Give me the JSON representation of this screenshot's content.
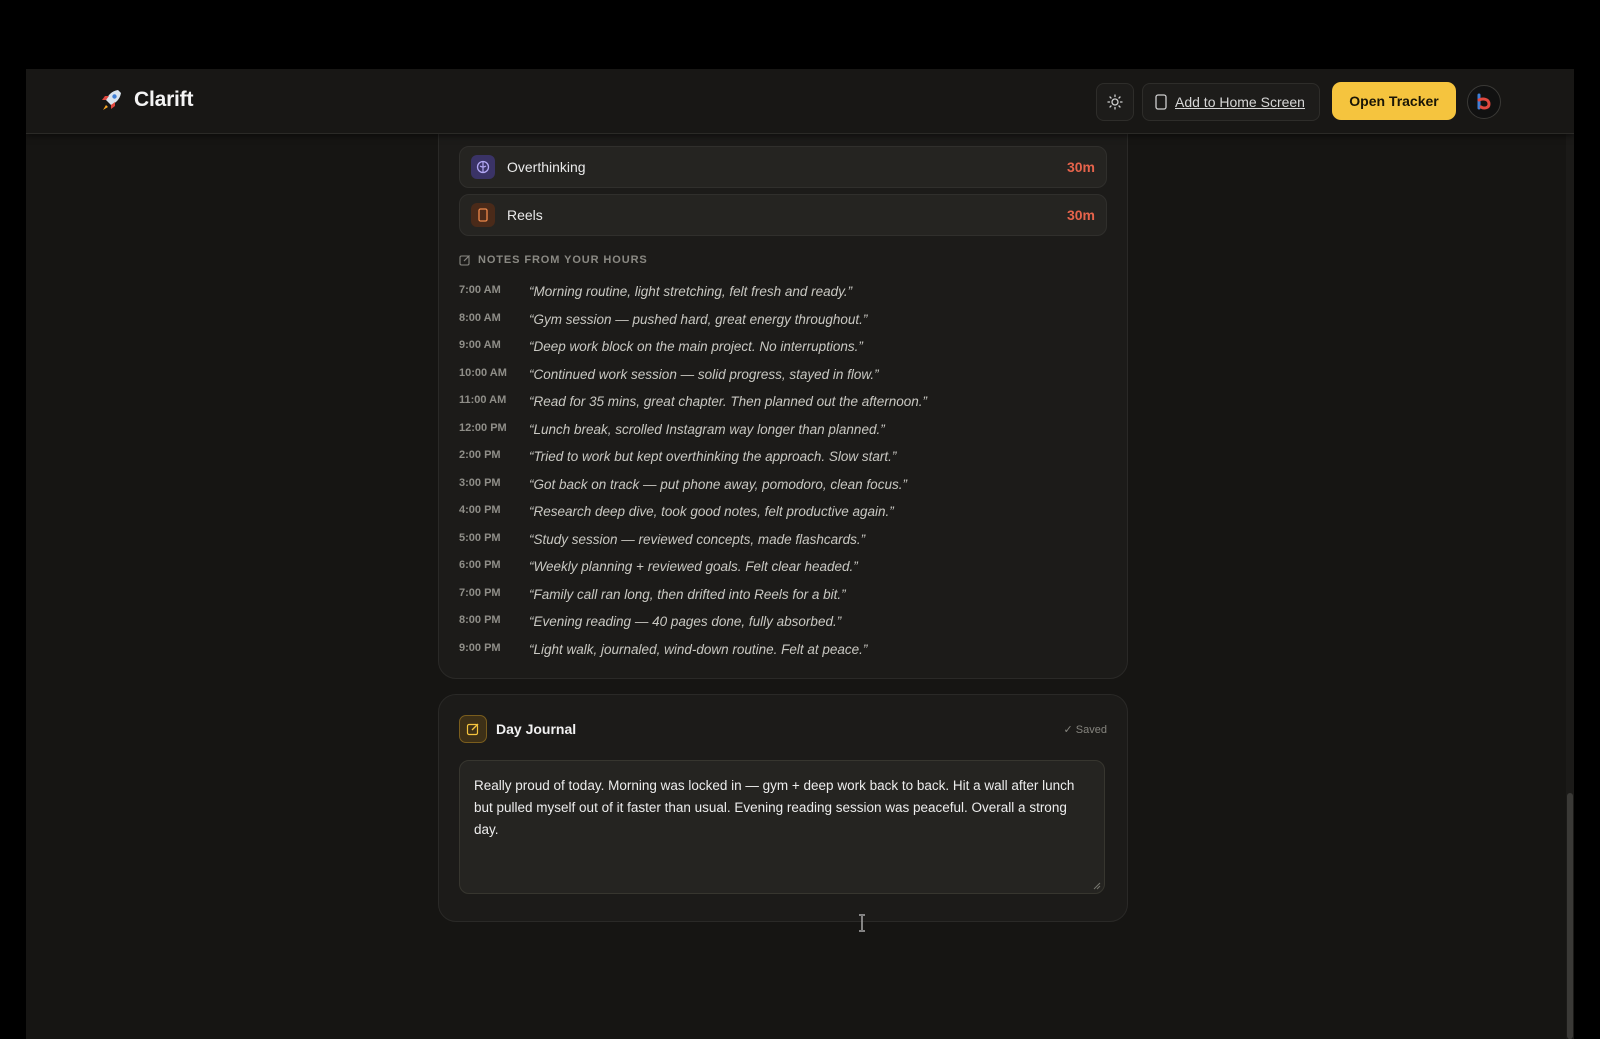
{
  "header": {
    "brand": "Clarift",
    "add_home_label": "Add to Home Screen",
    "open_tracker_label": "Open Tracker"
  },
  "habits": [
    {
      "name": "Overthinking",
      "time": "30m",
      "icon": "brain-icon",
      "color": "#7f6fd6"
    },
    {
      "name": "Reels",
      "time": "30m",
      "icon": "phone-icon",
      "color": "#e07a3c"
    }
  ],
  "notes": {
    "title": "NOTES FROM YOUR HOURS",
    "items": [
      {
        "time": "7:00 AM",
        "text": "“Morning routine, light stretching, felt fresh and ready.”"
      },
      {
        "time": "8:00 AM",
        "text": "“Gym session — pushed hard, great energy throughout.”"
      },
      {
        "time": "9:00 AM",
        "text": "“Deep work block on the main project. No interruptions.”"
      },
      {
        "time": "10:00 AM",
        "text": "“Continued work session — solid progress, stayed in flow.”"
      },
      {
        "time": "11:00 AM",
        "text": "“Read for 35 mins, great chapter. Then planned out the afternoon.”"
      },
      {
        "time": "12:00 PM",
        "text": "“Lunch break, scrolled Instagram way longer than planned.”"
      },
      {
        "time": "2:00 PM",
        "text": "“Tried to work but kept overthinking the approach. Slow start.”"
      },
      {
        "time": "3:00 PM",
        "text": "“Got back on track — put phone away, pomodoro, clean focus.”"
      },
      {
        "time": "4:00 PM",
        "text": "“Research deep dive, took good notes, felt productive again.”"
      },
      {
        "time": "5:00 PM",
        "text": "“Study session — reviewed concepts, made flashcards.”"
      },
      {
        "time": "6:00 PM",
        "text": "“Weekly planning + reviewed goals. Felt clear headed.”"
      },
      {
        "time": "7:00 PM",
        "text": "“Family call ran long, then drifted into Reels for a bit.”"
      },
      {
        "time": "8:00 PM",
        "text": "“Evening reading — 40 pages done, fully absorbed.”"
      },
      {
        "time": "9:00 PM",
        "text": "“Light walk, journaled, wind-down routine. Felt at peace.”"
      }
    ]
  },
  "journal": {
    "title": "Day Journal",
    "saved": "✓ Saved",
    "text": "Really proud of today. Morning was locked in — gym + deep work back to back. Hit a wall after lunch but pulled myself out of it faster than usual. Evening reading session was peaceful. Overall a strong day."
  },
  "colors": {
    "accent": "#f5c43e",
    "habit_time": "#e5634b",
    "background": "#161513"
  }
}
